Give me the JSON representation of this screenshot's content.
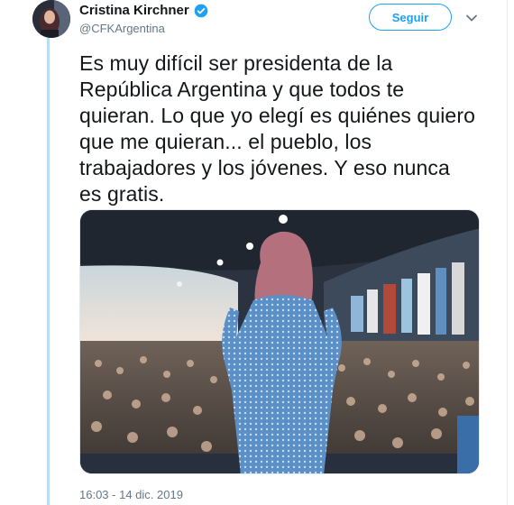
{
  "tweet": {
    "author_name": "Cristina Kirchner",
    "author_handle": "@CFKArgentina",
    "follow_label": "Seguir",
    "text": "Es muy difícil ser presidenta de la República Argentina y que todos te quieran. Lo que yo elegí es quiénes quiero que me quieran... el pueblo, los trabajadores y los jóvenes. Y eso nunca es gratis.",
    "timestamp": "16:03 - 14 dic. 2019"
  },
  "icons": {
    "verified": "verified-badge-icon",
    "menu": "chevron-down-icon"
  },
  "colors": {
    "accent": "#1da1f2",
    "text": "#14171a",
    "muted": "#657786"
  }
}
